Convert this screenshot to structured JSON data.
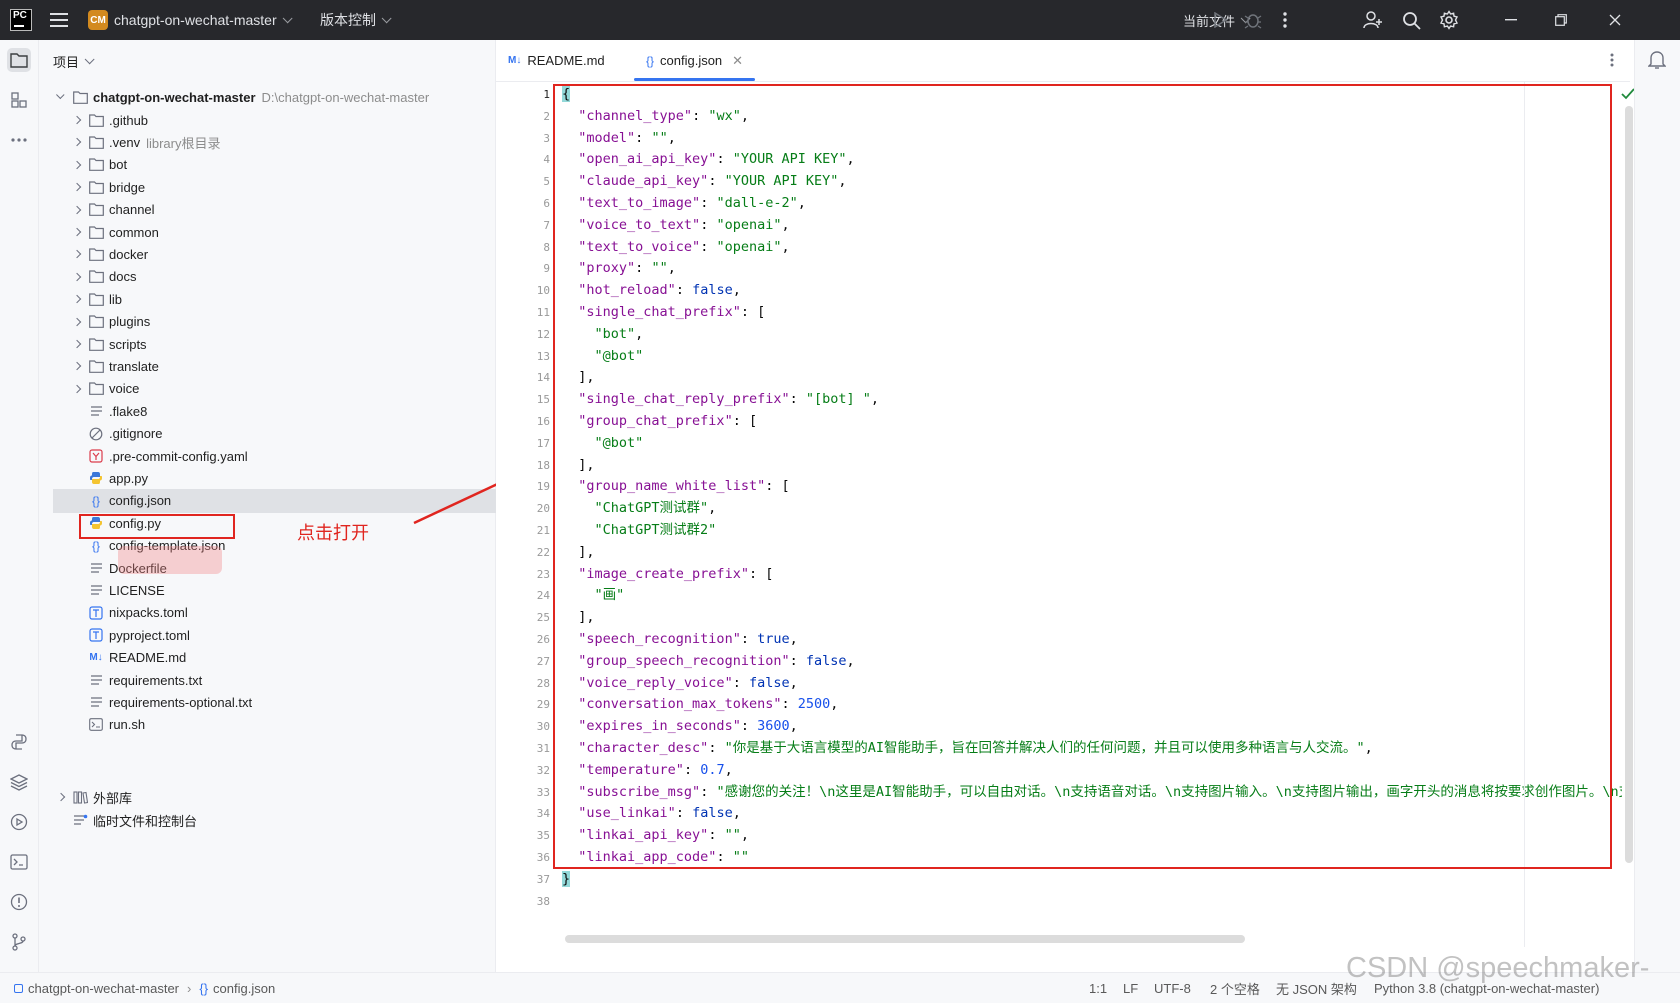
{
  "titlebar": {
    "app_badge": "PC",
    "project_badge": "CM",
    "project_name": "chatgpt-on-wechat-master",
    "vcs_label": "版本控制",
    "run_config": "当前文件"
  },
  "project_panel": {
    "title": "项目",
    "root": {
      "name": "chatgpt-on-wechat-master",
      "path": "D:\\chatgpt-on-wechat-master"
    },
    "items": [
      {
        "label": ".github",
        "hint": "",
        "icon": "folder-icon"
      },
      {
        "label": ".venv",
        "hint": "library根目录",
        "icon": "folder-icon"
      },
      {
        "label": "bot",
        "hint": "",
        "icon": "folder-icon"
      },
      {
        "label": "bridge",
        "hint": "",
        "icon": "folder-icon"
      },
      {
        "label": "channel",
        "hint": "",
        "icon": "folder-icon"
      },
      {
        "label": "common",
        "hint": "",
        "icon": "folder-icon"
      },
      {
        "label": "docker",
        "hint": "",
        "icon": "folder-icon"
      },
      {
        "label": "docs",
        "hint": "",
        "icon": "folder-icon"
      },
      {
        "label": "lib",
        "hint": "",
        "icon": "folder-icon"
      },
      {
        "label": "plugins",
        "hint": "",
        "icon": "folder-icon"
      },
      {
        "label": "scripts",
        "hint": "",
        "icon": "folder-icon"
      },
      {
        "label": "translate",
        "hint": "",
        "icon": "folder-icon"
      },
      {
        "label": "voice",
        "hint": "",
        "icon": "folder-icon"
      },
      {
        "label": ".flake8",
        "hint": "",
        "icon": "text-file-icon"
      },
      {
        "label": ".gitignore",
        "hint": "",
        "icon": "ignore-file-icon"
      },
      {
        "label": ".pre-commit-config.yaml",
        "hint": "",
        "icon": "yaml-file-icon"
      },
      {
        "label": "app.py",
        "hint": "",
        "icon": "python-file-icon"
      },
      {
        "label": "config.json",
        "hint": "",
        "icon": "json-file-icon"
      },
      {
        "label": "config.py",
        "hint": "",
        "icon": "python-file-icon"
      },
      {
        "label": "config-template.json",
        "hint": "",
        "icon": "json-file-icon"
      },
      {
        "label": "Dockerfile",
        "hint": "",
        "icon": "text-file-icon"
      },
      {
        "label": "LICENSE",
        "hint": "",
        "icon": "text-file-icon"
      },
      {
        "label": "nixpacks.toml",
        "hint": "",
        "icon": "toml-file-icon"
      },
      {
        "label": "pyproject.toml",
        "hint": "",
        "icon": "toml-file-icon"
      },
      {
        "label": "README.md",
        "hint": "",
        "icon": "markdown-file-icon"
      },
      {
        "label": "requirements.txt",
        "hint": "",
        "icon": "text-file-icon"
      },
      {
        "label": "requirements-optional.txt",
        "hint": "",
        "icon": "text-file-icon"
      },
      {
        "label": "run.sh",
        "hint": "",
        "icon": "shell-file-icon"
      }
    ],
    "external_libs": "外部库",
    "scratches": "临时文件和控制台"
  },
  "annotation": {
    "text": "点击打开"
  },
  "editor": {
    "tabs": [
      {
        "label": "README.md",
        "badge": "M↓",
        "active": false
      },
      {
        "label": "config.json",
        "badge": "{}",
        "active": true
      }
    ],
    "line_numbers": [
      "1",
      "2",
      "3",
      "4",
      "5",
      "6",
      "7",
      "8",
      "9",
      "10",
      "11",
      "12",
      "13",
      "14",
      "15",
      "16",
      "17",
      "18",
      "19",
      "20",
      "21",
      "22",
      "23",
      "24",
      "25",
      "26",
      "27",
      "28",
      "29",
      "30",
      "31",
      "32",
      "33",
      "34",
      "35",
      "36",
      "37",
      "38"
    ],
    "lines": [
      [
        [
          "p",
          "{"
        ]
      ],
      [
        [
          "p",
          "  "
        ],
        [
          "k",
          "\"channel_type\""
        ],
        [
          "p",
          ": "
        ],
        [
          "s",
          "\"wx\""
        ],
        [
          "p",
          ","
        ]
      ],
      [
        [
          "p",
          "  "
        ],
        [
          "k",
          "\"model\""
        ],
        [
          "p",
          ": "
        ],
        [
          "s",
          "\"\""
        ],
        [
          "p",
          ","
        ]
      ],
      [
        [
          "p",
          "  "
        ],
        [
          "k",
          "\"open_ai_api_key\""
        ],
        [
          "p",
          ": "
        ],
        [
          "s",
          "\"YOUR API KEY\""
        ],
        [
          "p",
          ","
        ]
      ],
      [
        [
          "p",
          "  "
        ],
        [
          "k",
          "\"claude_api_key\""
        ],
        [
          "p",
          ": "
        ],
        [
          "s",
          "\"YOUR API KEY\""
        ],
        [
          "p",
          ","
        ]
      ],
      [
        [
          "p",
          "  "
        ],
        [
          "k",
          "\"text_to_image\""
        ],
        [
          "p",
          ": "
        ],
        [
          "s",
          "\"dall-e-2\""
        ],
        [
          "p",
          ","
        ]
      ],
      [
        [
          "p",
          "  "
        ],
        [
          "k",
          "\"voice_to_text\""
        ],
        [
          "p",
          ": "
        ],
        [
          "s",
          "\"openai\""
        ],
        [
          "p",
          ","
        ]
      ],
      [
        [
          "p",
          "  "
        ],
        [
          "k",
          "\"text_to_voice\""
        ],
        [
          "p",
          ": "
        ],
        [
          "s",
          "\"openai\""
        ],
        [
          "p",
          ","
        ]
      ],
      [
        [
          "p",
          "  "
        ],
        [
          "k",
          "\"proxy\""
        ],
        [
          "p",
          ": "
        ],
        [
          "s",
          "\"\""
        ],
        [
          "p",
          ","
        ]
      ],
      [
        [
          "p",
          "  "
        ],
        [
          "k",
          "\"hot_reload\""
        ],
        [
          "p",
          ": "
        ],
        [
          "b",
          "false"
        ],
        [
          "p",
          ","
        ]
      ],
      [
        [
          "p",
          "  "
        ],
        [
          "k",
          "\"single_chat_prefix\""
        ],
        [
          "p",
          ": ["
        ]
      ],
      [
        [
          "p",
          "    "
        ],
        [
          "s",
          "\"bot\""
        ],
        [
          "p",
          ","
        ]
      ],
      [
        [
          "p",
          "    "
        ],
        [
          "s",
          "\"@bot\""
        ]
      ],
      [
        [
          "p",
          "  ],"
        ]
      ],
      [
        [
          "p",
          "  "
        ],
        [
          "k",
          "\"single_chat_reply_prefix\""
        ],
        [
          "p",
          ": "
        ],
        [
          "s",
          "\"[bot] \""
        ],
        [
          "p",
          ","
        ]
      ],
      [
        [
          "p",
          "  "
        ],
        [
          "k",
          "\"group_chat_prefix\""
        ],
        [
          "p",
          ": ["
        ]
      ],
      [
        [
          "p",
          "    "
        ],
        [
          "s",
          "\"@bot\""
        ]
      ],
      [
        [
          "p",
          "  ],"
        ]
      ],
      [
        [
          "p",
          "  "
        ],
        [
          "k",
          "\"group_name_white_list\""
        ],
        [
          "p",
          ": ["
        ]
      ],
      [
        [
          "p",
          "    "
        ],
        [
          "s",
          "\"ChatGPT测试群\""
        ],
        [
          "p",
          ","
        ]
      ],
      [
        [
          "p",
          "    "
        ],
        [
          "s",
          "\"ChatGPT测试群2\""
        ]
      ],
      [
        [
          "p",
          "  ],"
        ]
      ],
      [
        [
          "p",
          "  "
        ],
        [
          "k",
          "\"image_create_prefix\""
        ],
        [
          "p",
          ": ["
        ]
      ],
      [
        [
          "p",
          "    "
        ],
        [
          "s",
          "\"画\""
        ]
      ],
      [
        [
          "p",
          "  ],"
        ]
      ],
      [
        [
          "p",
          "  "
        ],
        [
          "k",
          "\"speech_recognition\""
        ],
        [
          "p",
          ": "
        ],
        [
          "b",
          "true"
        ],
        [
          "p",
          ","
        ]
      ],
      [
        [
          "p",
          "  "
        ],
        [
          "k",
          "\"group_speech_recognition\""
        ],
        [
          "p",
          ": "
        ],
        [
          "b",
          "false"
        ],
        [
          "p",
          ","
        ]
      ],
      [
        [
          "p",
          "  "
        ],
        [
          "k",
          "\"voice_reply_voice\""
        ],
        [
          "p",
          ": "
        ],
        [
          "b",
          "false"
        ],
        [
          "p",
          ","
        ]
      ],
      [
        [
          "p",
          "  "
        ],
        [
          "k",
          "\"conversation_max_tokens\""
        ],
        [
          "p",
          ": "
        ],
        [
          "n",
          "2500"
        ],
        [
          "p",
          ","
        ]
      ],
      [
        [
          "p",
          "  "
        ],
        [
          "k",
          "\"expires_in_seconds\""
        ],
        [
          "p",
          ": "
        ],
        [
          "n",
          "3600"
        ],
        [
          "p",
          ","
        ]
      ],
      [
        [
          "p",
          "  "
        ],
        [
          "k",
          "\"character_desc\""
        ],
        [
          "p",
          ": "
        ],
        [
          "s",
          "\"你是基于大语言模型的AI智能助手，旨在回答并解决人们的任何问题，并且可以使用多种语言与人交流。\""
        ],
        [
          "p",
          ","
        ]
      ],
      [
        [
          "p",
          "  "
        ],
        [
          "k",
          "\"temperature\""
        ],
        [
          "p",
          ": "
        ],
        [
          "n",
          "0.7"
        ],
        [
          "p",
          ","
        ]
      ],
      [
        [
          "p",
          "  "
        ],
        [
          "k",
          "\"subscribe_msg\""
        ],
        [
          "p",
          ": "
        ],
        [
          "s",
          "\"感谢您的关注！\\n这里是AI智能助手，可以自由对话。\\n支持语音对话。\\n支持图片输入。\\n支持图片输出，画字开头的消息将按要求创作图片。\\n支持too"
        ]
      ],
      [
        [
          "p",
          "  "
        ],
        [
          "k",
          "\"use_linkai\""
        ],
        [
          "p",
          ": "
        ],
        [
          "b",
          "false"
        ],
        [
          "p",
          ","
        ]
      ],
      [
        [
          "p",
          "  "
        ],
        [
          "k",
          "\"linkai_api_key\""
        ],
        [
          "p",
          ": "
        ],
        [
          "s",
          "\"\""
        ],
        [
          "p",
          ","
        ]
      ],
      [
        [
          "p",
          "  "
        ],
        [
          "k",
          "\"linkai_app_code\""
        ],
        [
          "p",
          ": "
        ],
        [
          "s",
          "\"\""
        ]
      ],
      [
        [
          "p",
          "}"
        ]
      ],
      [
        [
          "p",
          ""
        ]
      ]
    ]
  },
  "statusbar": {
    "breadcrumb_project": "chatgpt-on-wechat-master",
    "breadcrumb_file": "config.json",
    "position": "1:1",
    "line_sep": "LF",
    "encoding": "UTF-8",
    "indent": "2 个空格",
    "schema": "无 JSON 架构",
    "interpreter": "Python 3.8 (chatgpt-on-wechat-master)"
  },
  "watermark": "CSDN @speechmaker-",
  "colors": {
    "accent": "#3574f0",
    "annotation_red": "#e0251f",
    "titlebar_bg": "#27282c"
  }
}
